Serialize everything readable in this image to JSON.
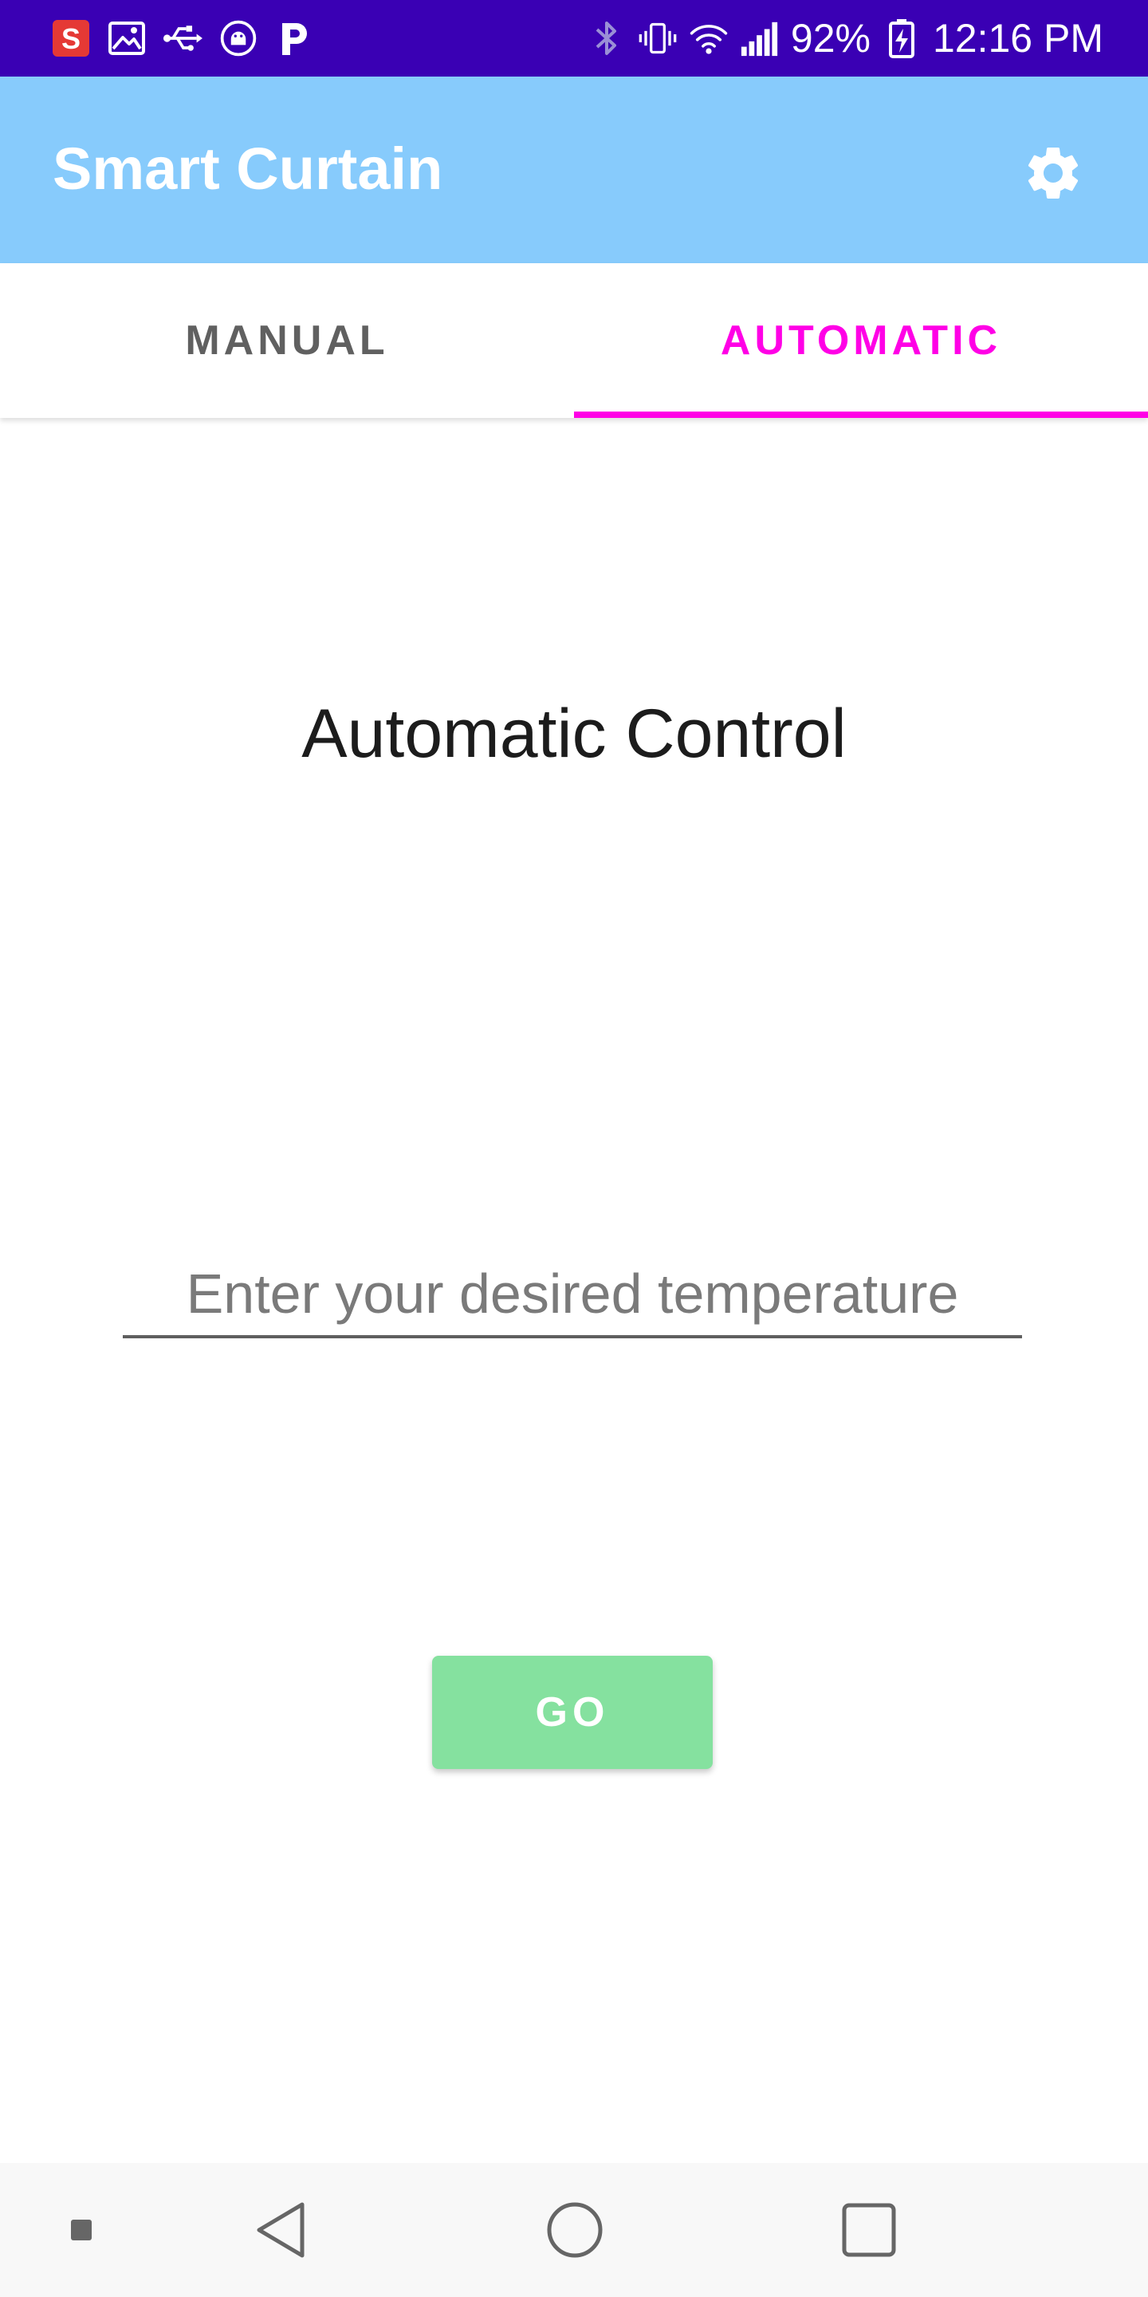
{
  "status_bar": {
    "battery": "92%",
    "time": "12:16 PM",
    "left_icons": [
      "s-app-icon",
      "image-icon",
      "usb-icon",
      "android-debug-icon",
      "p-app-icon"
    ],
    "right_icons": [
      "bluetooth-icon",
      "vibrate-icon",
      "wifi-icon",
      "signal-icon",
      "battery-charging-icon"
    ]
  },
  "app_bar": {
    "title": "Smart Curtain",
    "action_icon": "gear-icon"
  },
  "tabs": [
    {
      "label": "MANUAL",
      "selected": false
    },
    {
      "label": "AUTOMATIC",
      "selected": true
    }
  ],
  "main": {
    "headline": "Automatic Control",
    "temperature_input": {
      "value": "",
      "placeholder": "Enter your desired temperature"
    },
    "go_button_label": "GO"
  },
  "nav_bar": {
    "icons": [
      "small-square-icon",
      "back-icon",
      "home-icon",
      "recents-icon"
    ]
  },
  "colors": {
    "status_bar": "#3a00b4",
    "app_bar": "#87cbfc",
    "tab_accent": "#ff00e6",
    "tab_inactive": "#606060",
    "go_button": "#85e19f",
    "nav_bar": "#f8f8f8"
  }
}
